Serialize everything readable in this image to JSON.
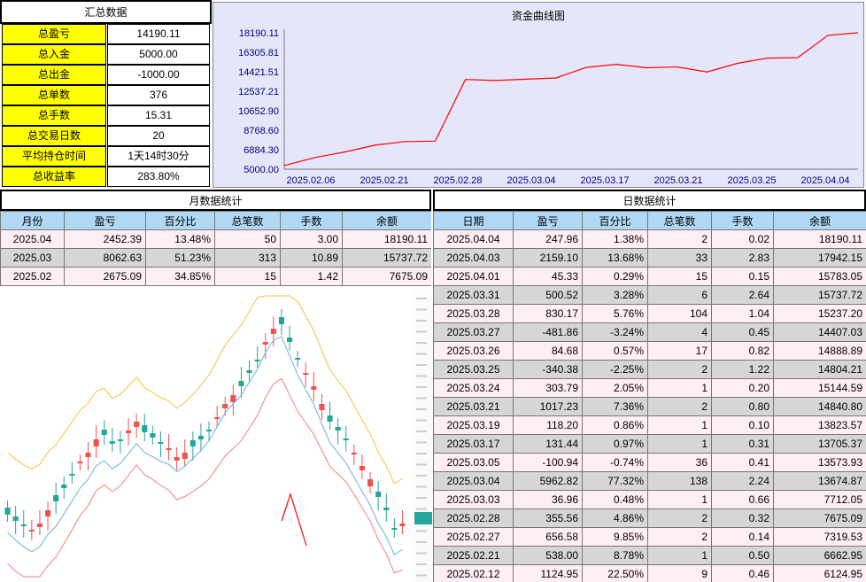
{
  "summary": {
    "title": "汇总数据",
    "rows": [
      {
        "label": "总盈亏",
        "value": "14190.11"
      },
      {
        "label": "总入金",
        "value": "5000.00"
      },
      {
        "label": "总出金",
        "value": "-1000.00"
      },
      {
        "label": "总单数",
        "value": "376"
      },
      {
        "label": "总手数",
        "value": "15.31"
      },
      {
        "label": "总交易日数",
        "value": "20"
      },
      {
        "label": "平均持仓时间",
        "value": "1天14时30分"
      },
      {
        "label": "总收益率",
        "value": "283.80%"
      }
    ]
  },
  "chart_data": {
    "type": "line",
    "title": "资金曲线图",
    "y_ticks": [
      "18190.11",
      "16305.81",
      "14421.51",
      "12537.21",
      "10652.90",
      "8768.60",
      "6884.30",
      "5000.00"
    ],
    "x_ticks": [
      "2025.02.06",
      "2025.02.21",
      "2025.02.28",
      "2025.03.04",
      "2025.03.17",
      "2025.03.21",
      "2025.03.25",
      "2025.04.04"
    ],
    "ylim": [
      5000.0,
      18190.11
    ],
    "series_color": "#ff0000",
    "values": [
      5350,
      6124.95,
      6662.95,
      7319.53,
      7675.09,
      7712.05,
      13674.87,
      13573.93,
      13705.37,
      13823.57,
      14840.8,
      15144.59,
      14804.21,
      14888.89,
      14407.03,
      15237.2,
      15737.72,
      15783.05,
      17942.15,
      18190.11
    ]
  },
  "month_table": {
    "title": "月数据统计",
    "headers": [
      "月份",
      "盈亏",
      "百分比",
      "总笔数",
      "手数",
      "余额"
    ],
    "rows": [
      [
        "2025.04",
        "2452.39",
        "13.48%",
        "50",
        "3.00",
        "18190.11"
      ],
      [
        "2025.03",
        "8062.63",
        "51.23%",
        "313",
        "10.89",
        "15737.72"
      ],
      [
        "2025.02",
        "2675.09",
        "34.85%",
        "15",
        "1.42",
        "7675.09"
      ]
    ]
  },
  "day_table": {
    "title": "日数据统计",
    "headers": [
      "日期",
      "盈亏",
      "百分比",
      "总笔数",
      "手数",
      "余额"
    ],
    "rows": [
      [
        "2025.04.04",
        "247.96",
        "1.38%",
        "2",
        "0.02",
        "18190.11"
      ],
      [
        "2025.04.03",
        "2159.10",
        "13.68%",
        "33",
        "2.83",
        "17942.15"
      ],
      [
        "2025.04.01",
        "45.33",
        "0.29%",
        "15",
        "0.15",
        "15783.05"
      ],
      [
        "2025.03.31",
        "500.52",
        "3.28%",
        "6",
        "2.64",
        "15737.72"
      ],
      [
        "2025.03.28",
        "830.17",
        "5.76%",
        "104",
        "1.04",
        "15237.20"
      ],
      [
        "2025.03.27",
        "-481.86",
        "-3.24%",
        "4",
        "0.45",
        "14407.03"
      ],
      [
        "2025.03.26",
        "84.68",
        "0.57%",
        "17",
        "0.82",
        "14888.89"
      ],
      [
        "2025.03.25",
        "-340.38",
        "-2.25%",
        "2",
        "1.22",
        "14804.21"
      ],
      [
        "2025.03.24",
        "303.79",
        "2.05%",
        "1",
        "0.20",
        "15144.59"
      ],
      [
        "2025.03.21",
        "1017.23",
        "7.36%",
        "2",
        "0.80",
        "14840.80"
      ],
      [
        "2025.03.19",
        "118.20",
        "0.86%",
        "1",
        "0.10",
        "13823.57"
      ],
      [
        "2025.03.17",
        "131.44",
        "0.97%",
        "1",
        "0.31",
        "13705.37"
      ],
      [
        "2025.03.05",
        "-100.94",
        "-0.74%",
        "36",
        "0.41",
        "13573.93"
      ],
      [
        "2025.03.04",
        "5962.82",
        "77.32%",
        "138",
        "2.24",
        "13674.87"
      ],
      [
        "2025.03.03",
        "36.96",
        "0.48%",
        "1",
        "0.66",
        "7712.05"
      ],
      [
        "2025.02.28",
        "355.56",
        "4.86%",
        "2",
        "0.32",
        "7675.09"
      ],
      [
        "2025.02.27",
        "656.58",
        "9.85%",
        "2",
        "0.14",
        "7319.53"
      ],
      [
        "2025.02.21",
        "538.00",
        "8.78%",
        "1",
        "0.50",
        "6662.95"
      ],
      [
        "2025.02.12",
        "1124.95",
        "22.50%",
        "9",
        "0.46",
        "6124.95"
      ]
    ]
  }
}
